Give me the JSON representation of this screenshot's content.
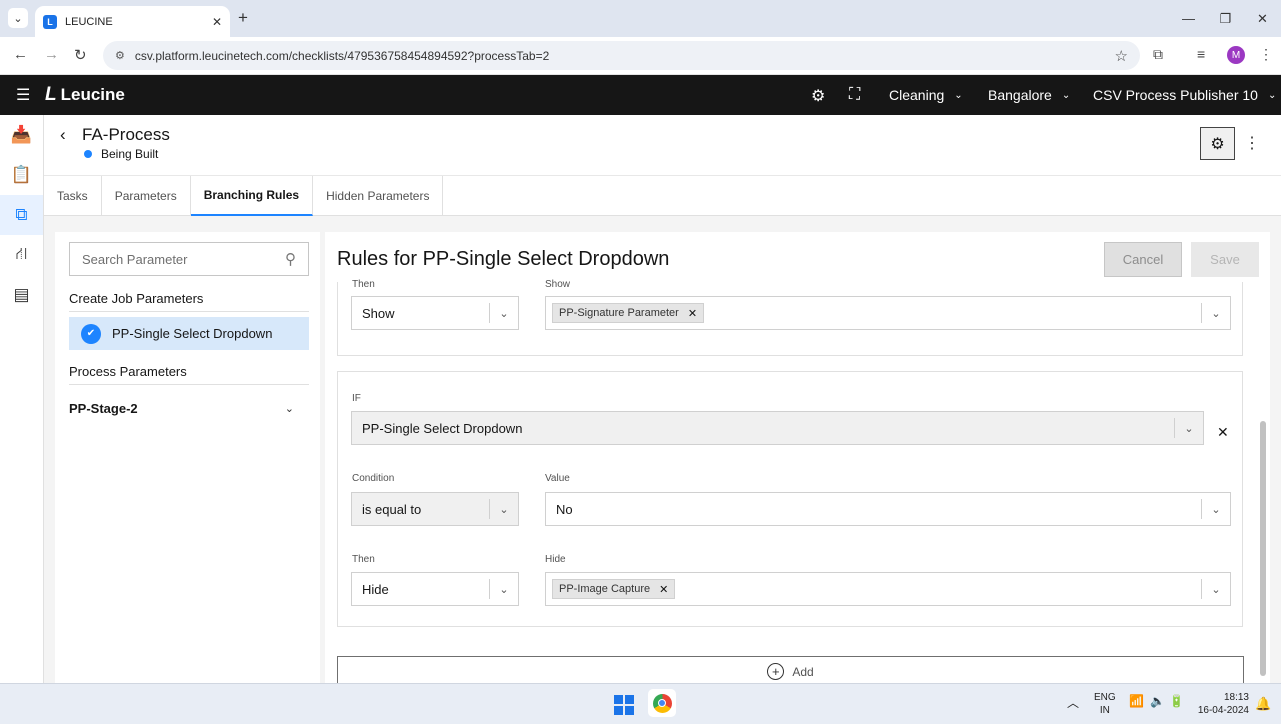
{
  "browser": {
    "tab_title": "LEUCINE",
    "favicon_letter": "L",
    "url": "csv.platform.leucinetech.com/checklists/479536758454894592?processTab=2",
    "profile_initial": "M"
  },
  "app_header": {
    "brand": "Leucine",
    "facility_dropdown": "Cleaning",
    "location_dropdown": "Bangalore",
    "user_dropdown": "CSV Process Publisher 10"
  },
  "page": {
    "title": "FA-Process",
    "status": "Being Built",
    "tabs": [
      "Tasks",
      "Parameters",
      "Branching Rules",
      "Hidden Parameters"
    ],
    "active_tab": "Branching Rules"
  },
  "left_panel": {
    "search_placeholder": "Search Parameter",
    "create_job_label": "Create Job Parameters",
    "selected_parameter": "PP-Single Select Dropdown",
    "process_label": "Process Parameters",
    "stage": "PP-Stage-2"
  },
  "rules": {
    "title": "Rules for PP-Single Select Dropdown",
    "cancel_label": "Cancel",
    "save_label": "Save",
    "rule1": {
      "then_label": "Then",
      "then_value": "Show",
      "target_label": "Show",
      "target_chip": "PP-Signature Parameter"
    },
    "rule2": {
      "if_label": "IF",
      "if_value": "PP-Single Select Dropdown",
      "condition_label": "Condition",
      "condition_value": "is equal to",
      "value_label": "Value",
      "value_value": "No",
      "then_label": "Then",
      "then_value": "Hide",
      "target_label": "Hide",
      "target_chip": "PP-Image Capture"
    },
    "add_label": "Add"
  },
  "taskbar": {
    "lang_1": "ENG",
    "lang_2": "IN",
    "time": "18:13",
    "date": "16-04-2024"
  },
  "colors": {
    "accent": "#1d84ff",
    "header_bg": "#161616",
    "selected_bg": "#d7e8fa"
  }
}
